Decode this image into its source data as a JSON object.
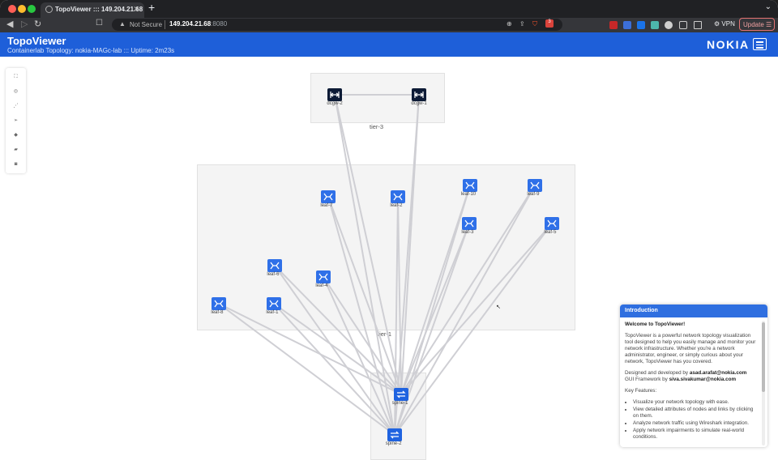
{
  "browser": {
    "tab_title": "TopoViewer ::: 149.204.21.68",
    "tab_close": "✕",
    "new_tab": "+",
    "address_security": "Not Secure",
    "address_host": "149.204.21.68",
    "address_port": ":8080",
    "vpn_label": "VPN",
    "update_label": "Update",
    "badge_count": "3",
    "accent": "#1e5fd9"
  },
  "app": {
    "title": "TopoViewer",
    "subtitle": "Containerlab Topology: nokia-MAGc-lab ::: Uptime: 2m23s",
    "logo_text": "NOKIA"
  },
  "groups": {
    "tier3": "tier-3",
    "tier1": "tier-1"
  },
  "nodes": [
    {
      "id": "dcgw-2",
      "label": "dcgw-2",
      "role": "dcgw"
    },
    {
      "id": "dcgw-1",
      "label": "dcgw-1",
      "role": "dcgw"
    },
    {
      "id": "leaf-7",
      "label": "leaf-7",
      "role": "leaf"
    },
    {
      "id": "leaf-2",
      "label": "leaf-2",
      "role": "leaf"
    },
    {
      "id": "leaf-10",
      "label": "leaf-10",
      "role": "leaf"
    },
    {
      "id": "leaf-9",
      "label": "leaf-9",
      "role": "leaf"
    },
    {
      "id": "leaf-3",
      "label": "leaf-3",
      "role": "leaf"
    },
    {
      "id": "leaf-5",
      "label": "leaf-5",
      "role": "leaf"
    },
    {
      "id": "leaf-6",
      "label": "leaf-6",
      "role": "leaf"
    },
    {
      "id": "leaf-4",
      "label": "leaf-4",
      "role": "leaf"
    },
    {
      "id": "leaf-8",
      "label": "leaf-8",
      "role": "leaf"
    },
    {
      "id": "leaf-1",
      "label": "leaf-1",
      "role": "leaf"
    },
    {
      "id": "spine-1",
      "label": "spine-1",
      "role": "spine"
    },
    {
      "id": "spine-2",
      "label": "spine-2",
      "role": "spine"
    }
  ],
  "links": [
    [
      "dcgw-2",
      "dcgw-1"
    ],
    [
      "dcgw-2",
      "spine-1"
    ],
    [
      "dcgw-2",
      "spine-2"
    ],
    [
      "dcgw-1",
      "spine-1"
    ],
    [
      "dcgw-1",
      "spine-2"
    ],
    [
      "leaf-7",
      "spine-1"
    ],
    [
      "leaf-7",
      "spine-2"
    ],
    [
      "leaf-2",
      "spine-1"
    ],
    [
      "leaf-2",
      "spine-2"
    ],
    [
      "leaf-10",
      "spine-1"
    ],
    [
      "leaf-10",
      "spine-2"
    ],
    [
      "leaf-9",
      "spine-1"
    ],
    [
      "leaf-9",
      "spine-2"
    ],
    [
      "leaf-3",
      "spine-1"
    ],
    [
      "leaf-3",
      "spine-2"
    ],
    [
      "leaf-5",
      "spine-1"
    ],
    [
      "leaf-5",
      "spine-2"
    ],
    [
      "leaf-6",
      "spine-1"
    ],
    [
      "leaf-6",
      "spine-2"
    ],
    [
      "leaf-4",
      "spine-1"
    ],
    [
      "leaf-4",
      "spine-2"
    ],
    [
      "leaf-8",
      "spine-1"
    ],
    [
      "leaf-8",
      "spine-2"
    ],
    [
      "leaf-1",
      "spine-1"
    ],
    [
      "leaf-1",
      "spine-2"
    ]
  ],
  "tools": [
    "fit-view-icon",
    "target-icon",
    "layout-icon",
    "send-icon",
    "tag-icon",
    "docker-icon",
    "camera-icon"
  ],
  "intro": {
    "header": "Introduction",
    "welcome": "Welcome to TopoViewer!",
    "description": "TopoViewer is a powerful network topology visualization tool designed to help you easily manage and monitor your network infrastructure. Whether you're a network administrator, engineer, or simply curious about your network, TopoViewer has you covered.",
    "designed_by_prefix": "Designed and developed by",
    "designed_by": "asad.arafat@nokia.com",
    "gui_prefix": "GUI Framework by",
    "gui_by": "siva.sivakumar@nokia.com",
    "features_title": "Key Features:",
    "features": [
      "Visualize your network topology with ease.",
      "View detailed attributes of nodes and links by clicking on them.",
      "Analyze network traffic using Wireshark integration.",
      "Apply network impairments to simulate real-world conditions."
    ]
  }
}
